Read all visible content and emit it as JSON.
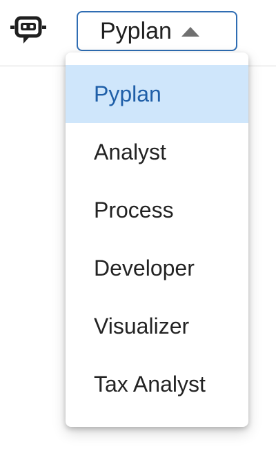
{
  "header": {
    "assistant_icon": "assistant-chat-icon",
    "mode_select": {
      "selected_label": "Pyplan",
      "caret_icon": "caret-up-icon",
      "border_color": "#2f6db3"
    }
  },
  "dropdown": {
    "selected_index": 0,
    "selected_background": "#cfe6fb",
    "selected_text_color": "#1f5fa8",
    "options": [
      {
        "label": "Pyplan"
      },
      {
        "label": "Analyst"
      },
      {
        "label": "Process"
      },
      {
        "label": "Developer"
      },
      {
        "label": "Visualizer"
      },
      {
        "label": "Tax Analyst"
      }
    ]
  }
}
